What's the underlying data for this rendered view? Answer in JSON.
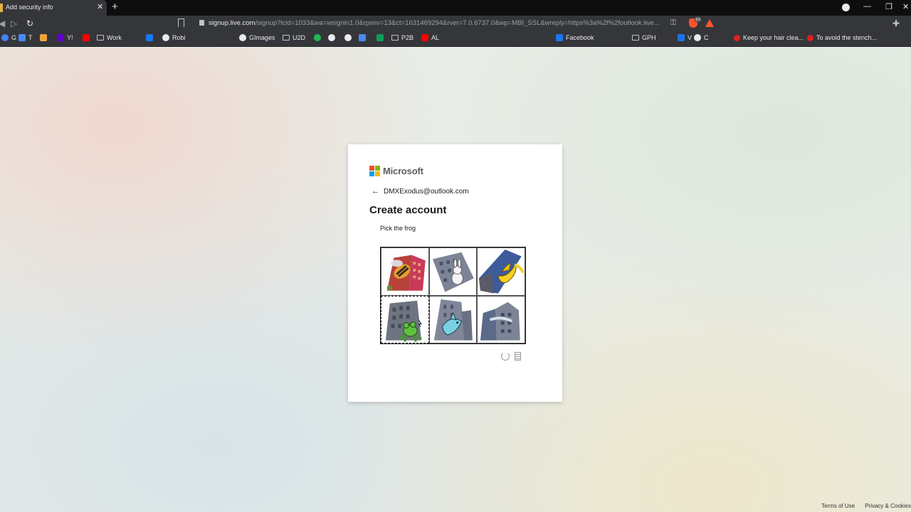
{
  "browser": {
    "tab_title": "Add security info",
    "tab_close": "✕",
    "new_tab": "+",
    "window_controls": [
      "—",
      "❐",
      "✕"
    ],
    "url_host": "signup.live.com",
    "url_rest": "/signup?lcid=1033&wa=wsignin1.0&rpsnv=13&ct=1631469294&rver=7.0.6737.0&wp=MBI_SSL&wreply=https%3a%2f%2foutlook.live...",
    "brave_badge": "10"
  },
  "bookmarks": [
    {
      "label": "G",
      "icon": "google",
      "color": "#4285f4"
    },
    {
      "label": "T",
      "icon": "translate",
      "color": "#4a8af4"
    },
    {
      "label": "",
      "icon": "bookmark",
      "color": "#f2a33a"
    },
    {
      "label": "Y!",
      "icon": "yahoo",
      "color": "#6001d2"
    },
    {
      "label": "",
      "icon": "youtube",
      "color": "#ff0000"
    },
    {
      "label": "Work",
      "icon": "folder",
      "color": ""
    },
    {
      "label": "",
      "icon": "facebook",
      "color": "#1877f2"
    },
    {
      "label": "Robi",
      "icon": "globe",
      "color": "#e8eaed"
    },
    {
      "label": "GImages",
      "icon": "google",
      "color": "#e8eaed"
    },
    {
      "label": "U2D",
      "icon": "folder",
      "color": ""
    },
    {
      "label": "",
      "icon": "spotify",
      "color": "#1db954"
    },
    {
      "label": "",
      "icon": "google",
      "color": "#e8eaed"
    },
    {
      "label": "",
      "icon": "globe",
      "color": "#e8eaed"
    },
    {
      "label": "",
      "icon": "translate",
      "color": "#4a8af4"
    },
    {
      "label": "",
      "icon": "plus-square",
      "color": "#0f9d58"
    },
    {
      "label": "P2B",
      "icon": "folder",
      "color": ""
    },
    {
      "label": "AL",
      "icon": "youtube",
      "color": "#ff0000"
    },
    {
      "label": "Facebook",
      "icon": "facebook",
      "color": "#1877f2"
    },
    {
      "label": "GPH",
      "icon": "folder",
      "color": ""
    },
    {
      "label": "V",
      "icon": "v-logo",
      "color": "#1a73e8"
    },
    {
      "label": "C",
      "icon": "google",
      "color": "#e8eaed"
    },
    {
      "label": "Keep your hair clea...",
      "icon": "red-dot",
      "color": "#e02020"
    },
    {
      "label": "To avoid the stench...",
      "icon": "red-dot",
      "color": "#e02020"
    }
  ],
  "card": {
    "brand": "Microsoft",
    "logo_colors": [
      "#f25022",
      "#7fba00",
      "#00a4ef",
      "#ffb900"
    ],
    "back_icon": "←",
    "email": "DMXExodus@outlook.com",
    "heading": "Create account",
    "instruction": "Pick the frog",
    "captcha_tiles": [
      {
        "subject": "bee on building",
        "selected": false
      },
      {
        "subject": "rabbit on building",
        "selected": false
      },
      {
        "subject": "banana on building",
        "selected": false
      },
      {
        "subject": "frog on building",
        "selected": true
      },
      {
        "subject": "dolphin on building",
        "selected": false
      },
      {
        "subject": "building",
        "selected": false
      }
    ]
  },
  "footer": {
    "terms": "Terms of Use",
    "privacy": "Privacy & Cookies"
  }
}
